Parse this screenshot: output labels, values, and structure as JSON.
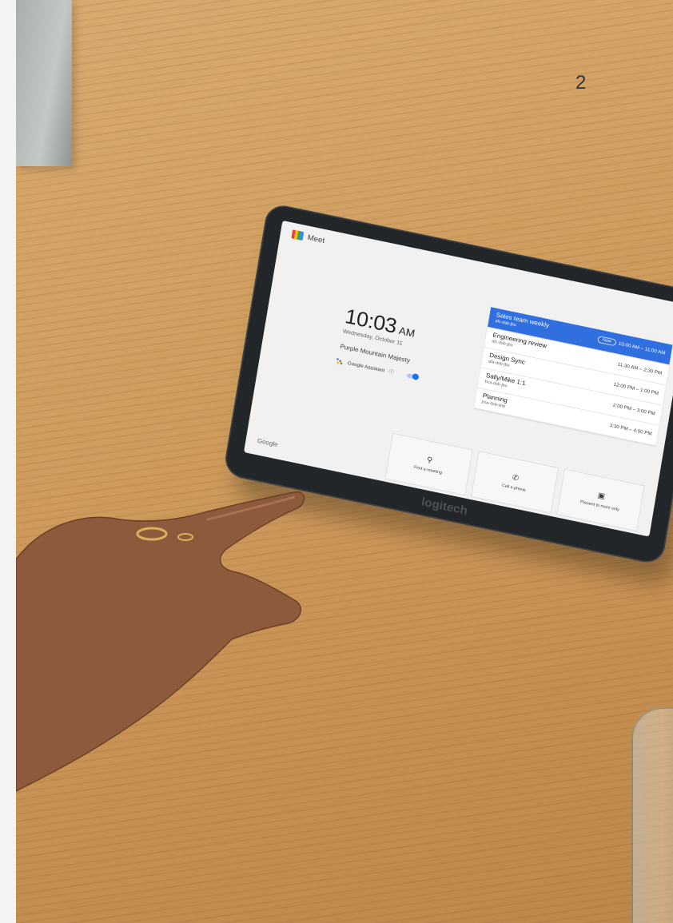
{
  "page": {
    "page_number": "2"
  },
  "device": {
    "brand": "logitech"
  },
  "meet": {
    "app_title": "Meet",
    "time": "10:03",
    "ampm": "AM",
    "date": "Wednesday, October 11",
    "room_name": "Purple Mountain Majesty",
    "assistant_label": "Google Assistant",
    "google_label": "Google",
    "now_label": "Now",
    "meetings": [
      {
        "name": "Sales team weekly",
        "code": "afc-dsb-jbo",
        "time": "10:00 AM – 11:00 AM",
        "active": true
      },
      {
        "name": "Engineering review",
        "code": "afc-dsb-jbo",
        "time": "11:30 AM – 2:30 PM"
      },
      {
        "name": "Design Sync",
        "code": "afa-dsb-jbo",
        "time": "12:00 PM – 1:00 PM"
      },
      {
        "name": "Sally/Mike 1:1",
        "code": "bca-dsb-jbo",
        "time": "2:00 PM – 3:00 PM"
      },
      {
        "name": "Planning",
        "code": "pna-dsb-shb",
        "time": "3:30 PM – 4:00 PM"
      }
    ],
    "actions": [
      {
        "label": "Find a meeting",
        "icon": "search-icon"
      },
      {
        "label": "Call a phone",
        "icon": "phone-icon"
      },
      {
        "label": "Present to room only",
        "icon": "present-icon"
      }
    ],
    "header_icons": [
      "gear-icon",
      "feedback-icon"
    ]
  },
  "colors": {
    "active_meeting": "#2f6fe0",
    "table_wood": "#cf9d5e",
    "device_bezel": "#232629"
  }
}
